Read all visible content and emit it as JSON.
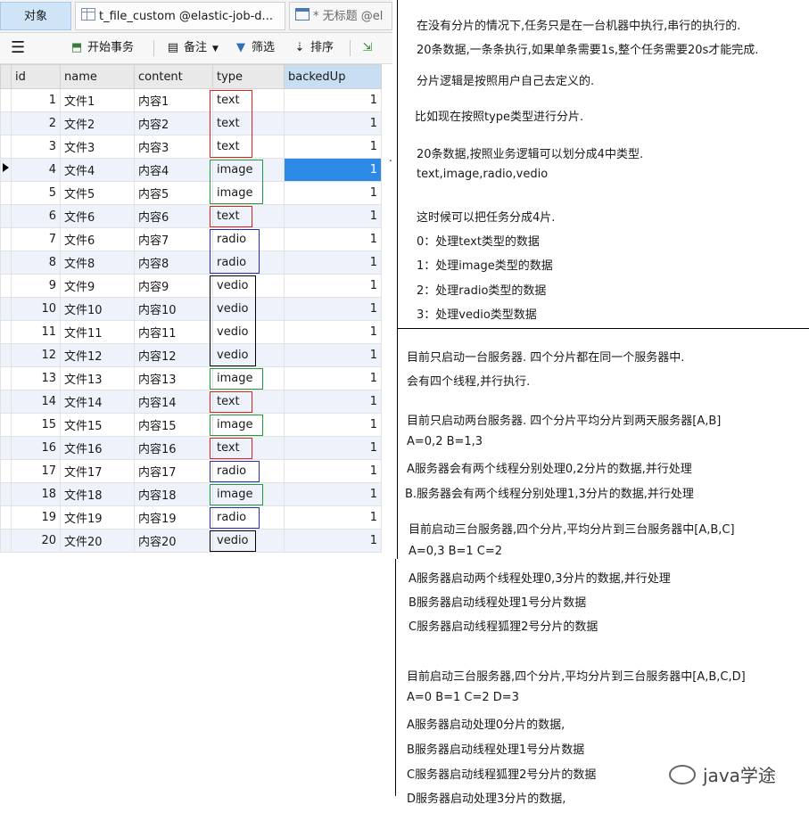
{
  "tabs": {
    "objects": "对象",
    "table": "t_file_custom @elastic-job-d...",
    "query": "* 无标题 @el"
  },
  "toolbar": {
    "menu_icon": "hamburger-icon",
    "begin_transaction": "开始事务",
    "memo": "备注",
    "filter": "筛选",
    "sort": "排序"
  },
  "table": {
    "columns": [
      "id",
      "name",
      "content",
      "type",
      "backedUp"
    ],
    "rows": [
      {
        "id": "1",
        "name": "文件1",
        "content": "内容1",
        "type": "text",
        "backedUp": "1"
      },
      {
        "id": "2",
        "name": "文件2",
        "content": "内容2",
        "type": "text",
        "backedUp": "1"
      },
      {
        "id": "3",
        "name": "文件3",
        "content": "内容3",
        "type": "text",
        "backedUp": "1"
      },
      {
        "id": "4",
        "name": "文件4",
        "content": "内容4",
        "type": "image",
        "backedUp": "1"
      },
      {
        "id": "5",
        "name": "文件5",
        "content": "内容5",
        "type": "image",
        "backedUp": "1"
      },
      {
        "id": "6",
        "name": "文件6",
        "content": "内容6",
        "type": "text",
        "backedUp": "1"
      },
      {
        "id": "7",
        "name": "文件6",
        "content": "内容7",
        "type": "radio",
        "backedUp": "1"
      },
      {
        "id": "8",
        "name": "文件8",
        "content": "内容8",
        "type": "radio",
        "backedUp": "1"
      },
      {
        "id": "9",
        "name": "文件9",
        "content": "内容9",
        "type": "vedio",
        "backedUp": "1"
      },
      {
        "id": "10",
        "name": "文件10",
        "content": "内容10",
        "type": "vedio",
        "backedUp": "1"
      },
      {
        "id": "11",
        "name": "文件11",
        "content": "内容11",
        "type": "vedio",
        "backedUp": "1"
      },
      {
        "id": "12",
        "name": "文件12",
        "content": "内容12",
        "type": "vedio",
        "backedUp": "1"
      },
      {
        "id": "13",
        "name": "文件13",
        "content": "内容13",
        "type": "image",
        "backedUp": "1"
      },
      {
        "id": "14",
        "name": "文件14",
        "content": "内容14",
        "type": "text",
        "backedUp": "1"
      },
      {
        "id": "15",
        "name": "文件15",
        "content": "内容15",
        "type": "image",
        "backedUp": "1"
      },
      {
        "id": "16",
        "name": "文件16",
        "content": "内容16",
        "type": "text",
        "backedUp": "1"
      },
      {
        "id": "17",
        "name": "文件17",
        "content": "内容17",
        "type": "radio",
        "backedUp": "1"
      },
      {
        "id": "18",
        "name": "文件18",
        "content": "内容18",
        "type": "image",
        "backedUp": "1"
      },
      {
        "id": "19",
        "name": "文件19",
        "content": "内容19",
        "type": "radio",
        "backedUp": "1"
      },
      {
        "id": "20",
        "name": "文件20",
        "content": "内容20",
        "type": "vedio",
        "backedUp": "1"
      }
    ],
    "selected_row": "4"
  },
  "type_colors": {
    "text": "#e02020",
    "image": "#1e9e3a",
    "radio": "#2b2bb0",
    "vedio": "#000000"
  },
  "notes_top": {
    "n1": "在没有分片的情况下,任务只是在一台机器中执行,串行的执行的.",
    "n2": "20条数据,一条条执行,如果单条需要1s,整个任务需要20s才能完成.",
    "n3": "分片逻辑是按照用户自己去定义的.",
    "n4": "比如现在按照type类型进行分片.",
    "n5": "20条数据,按照业务逻辑可以划分成4中类型.",
    "n6": "text,image,radio,vedio",
    "n7": "这时候可以把任务分成4片.",
    "n8": "0：处理text类型的数据",
    "n9": "1：处理image类型的数据",
    "n10": "2：处理radio类型的数据",
    "n11": "3：处理vedio类型数据"
  },
  "notes_bottom": {
    "b1": "目前只启动一台服务器.  四个分片都在同一个服务器中.",
    "b2": "会有四个线程,并行执行.",
    "b3": "目前只启动两台服务器. 四个分片平均分片到两天服务器[A,B]",
    "b4": "A=0,2 B=1,3",
    "b5": "A服务器会有两个线程分别处理0,2分片的数据,并行处理",
    "b6": "B.服务器会有两个线程分别处理1,3分片的数据,并行处理",
    "b7": "目前启动三台服务器,四个分片,平均分片到三台服务器中[A,B,C]",
    "b8": "A=0,3 B=1 C=2",
    "b9": "A服务器启动两个线程处理0,3分片的数据,并行处理",
    "b10": "B服务器启动线程处理1号分片数据",
    "b11": "C服务器启动线程狐狸2号分片的数据",
    "b12": "目前启动三台服务器,四个分片,平均分片到三台服务器中[A,B,C,D]",
    "b13": "A=0 B=1 C=2 D=3",
    "b14": "A服务器启动处理0分片的数据,",
    "b15": "B服务器启动线程处理1号分片数据",
    "b16": "C服务器启动线程狐狸2号分片的数据",
    "b17": "D服务器启动处理3分片的数据,"
  },
  "watermark": "java学途",
  "misc": {
    "dot": "."
  }
}
